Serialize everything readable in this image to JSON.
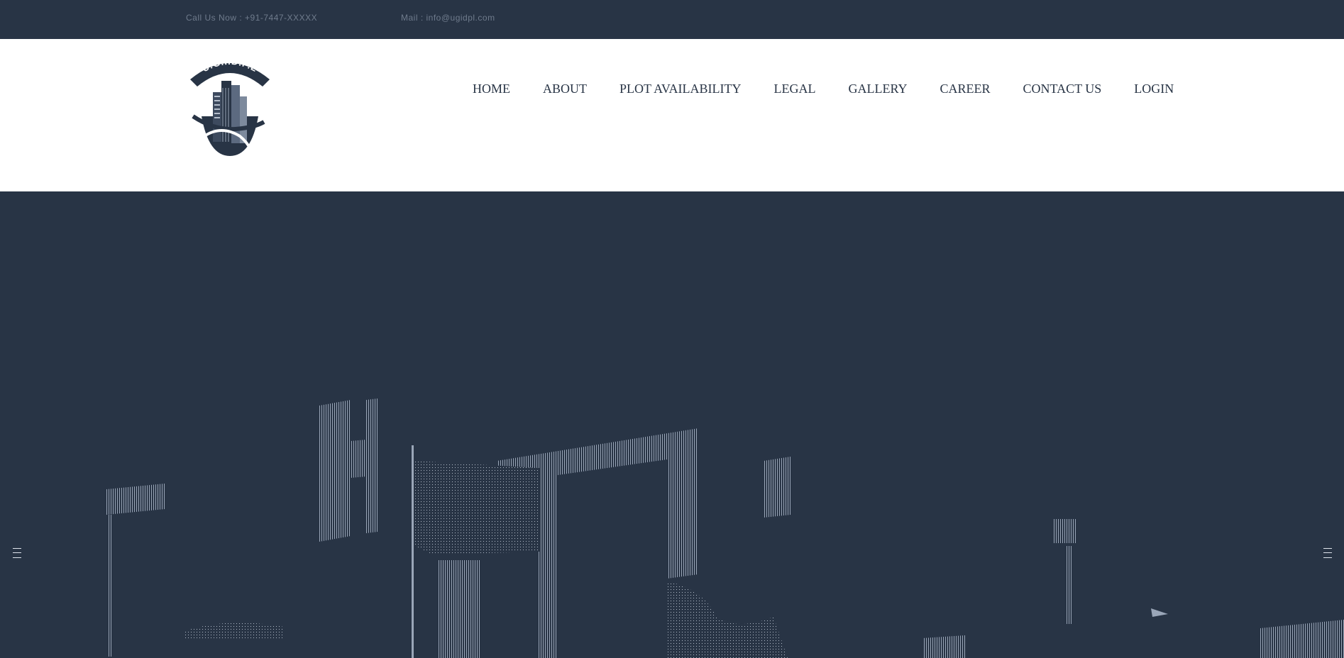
{
  "topbar": {
    "phone": "Call Us Now : +91-7447-XXXXX",
    "email": "Mail : info@ugidpl.com"
  },
  "logo": {
    "text": "U.G.I.D.P.L"
  },
  "nav": {
    "items": [
      "HOME",
      "ABOUT",
      "PLOT AVAILABILITY",
      "LEGAL",
      "GALLERY",
      "CAREER",
      "CONTACT US",
      "LOGIN"
    ]
  },
  "colors": {
    "dark": "#283445",
    "light": "#ffffff",
    "accent": "#9aa6b8"
  },
  "slider": {
    "prev_icon": "chevron-left-icon",
    "next_icon": "chevron-right-icon"
  }
}
